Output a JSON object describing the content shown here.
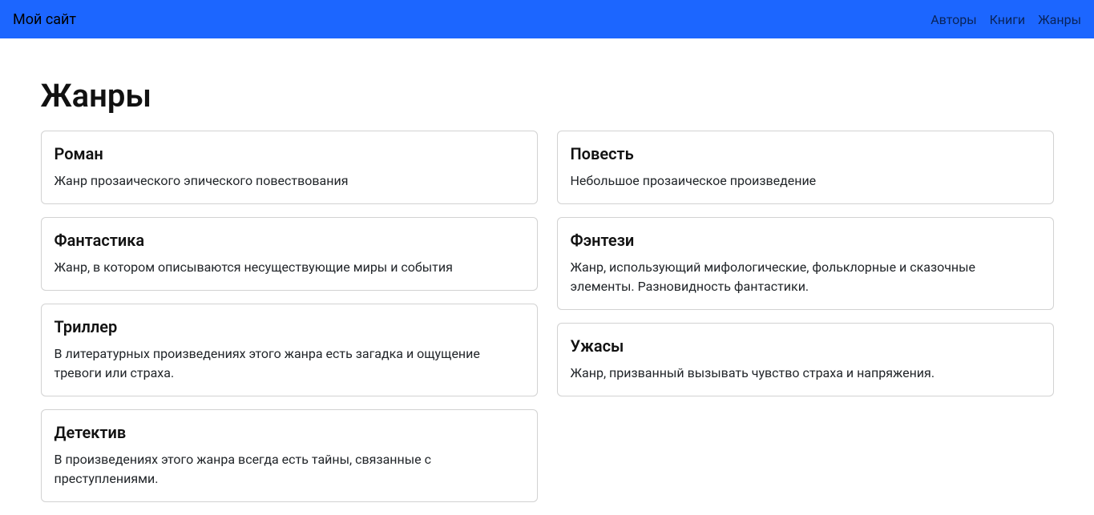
{
  "navbar": {
    "brand": "Мой сайт",
    "links": [
      {
        "label": "Авторы"
      },
      {
        "label": "Книги"
      },
      {
        "label": "Жанры"
      }
    ]
  },
  "page": {
    "title": "Жанры"
  },
  "genres": {
    "left": [
      {
        "title": "Роман",
        "desc": "Жанр прозаического эпического повествования"
      },
      {
        "title": "Фантастика",
        "desc": "Жанр, в котором описываются несуществующие миры и события"
      },
      {
        "title": "Триллер",
        "desc": "В литературных произведениях этого жанра есть загадка и ощущение тревоги или страха."
      },
      {
        "title": "Детектив",
        "desc": "В произведениях этого жанра всегда есть тайны, связанные с преступлениями."
      }
    ],
    "right": [
      {
        "title": "Повесть",
        "desc": "Небольшое прозаическое произведение"
      },
      {
        "title": "Фэнтези",
        "desc": "Жанр, использующий мифологические, фольклорные и сказочные элементы. Разновидность фантастики."
      },
      {
        "title": "Ужасы",
        "desc": "Жанр, призванный вызывать чувство страха и напряжения."
      }
    ]
  }
}
